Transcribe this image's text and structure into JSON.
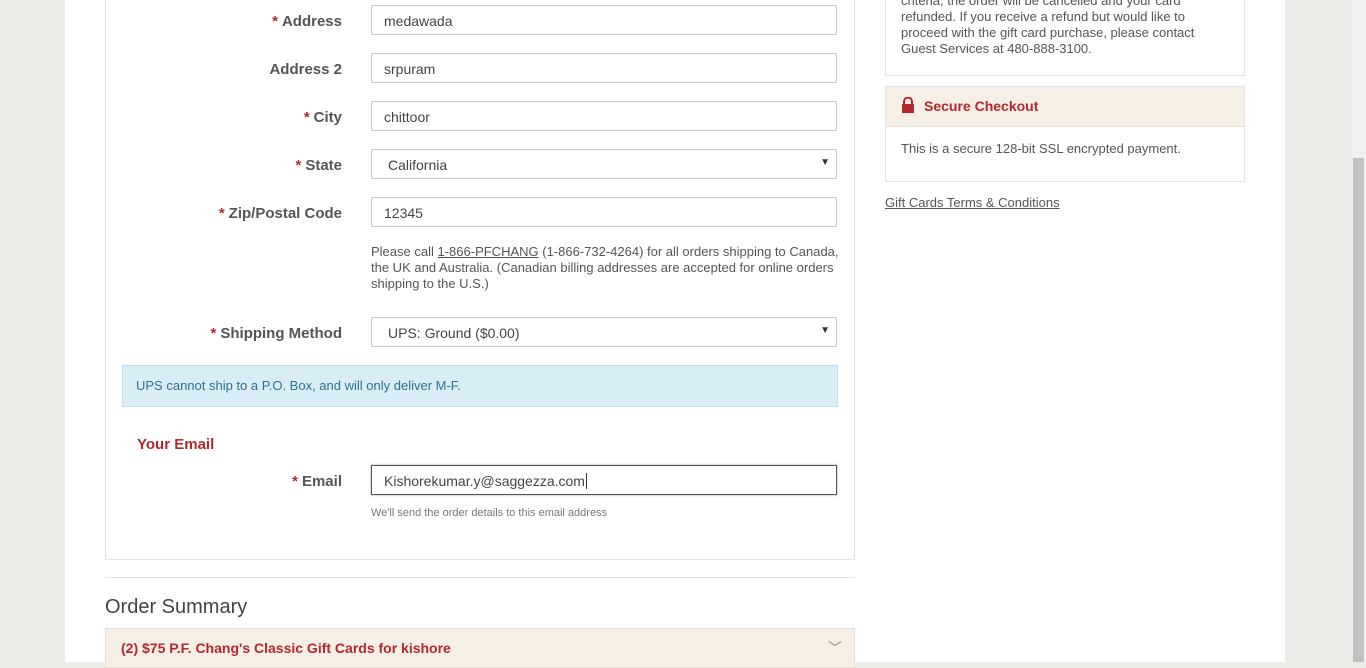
{
  "form": {
    "address": {
      "label": "Address",
      "value": "medawada",
      "required": true
    },
    "address2": {
      "label": "Address 2",
      "value": "srpuram",
      "required": false
    },
    "city": {
      "label": "City",
      "value": "chittoor",
      "required": true
    },
    "state": {
      "label": "State",
      "value": "California",
      "required": true
    },
    "zip": {
      "label": "Zip/Postal Code",
      "value": "12345",
      "required": true
    },
    "shipping_help": {
      "prefix": "Please call ",
      "phone_link": "1-866-PFCHANG",
      "suffix": " (1-866-732-4264) for all orders shipping to Canada, the UK and Australia. (Canadian billing addresses are accepted for online orders shipping to the U.S.)"
    },
    "shipping_method": {
      "label": "Shipping Method",
      "value": "UPS: Ground ($0.00)",
      "required": true
    },
    "ups_notice": "UPS cannot ship to a P.O. Box, and will only deliver M-F.",
    "email_section_title": "Your Email",
    "email": {
      "label": "Email",
      "value": "Kishorekumar.y@saggezza.com",
      "required": true
    },
    "email_note": "We'll send the order details to this email address",
    "required_marker": "*"
  },
  "order_summary": {
    "title": "Order Summary",
    "item": "(2) $75 P.F. Chang's Classic Gift Cards for kishore"
  },
  "sidebar": {
    "policy_text": "criteria, the order will be cancelled and your card refunded. If you receive a refund but would like to proceed with the gift card purchase, please contact Guest Services at 480-888-3100.",
    "secure_title": "Secure Checkout",
    "secure_text": "This is a secure 128-bit SSL encrypted payment.",
    "terms_link": "Gift Cards Terms & Conditions"
  },
  "colors": {
    "brand_red": "#b3282d",
    "info_bg": "#d9edf7",
    "accent_bg": "#f5efe6"
  }
}
